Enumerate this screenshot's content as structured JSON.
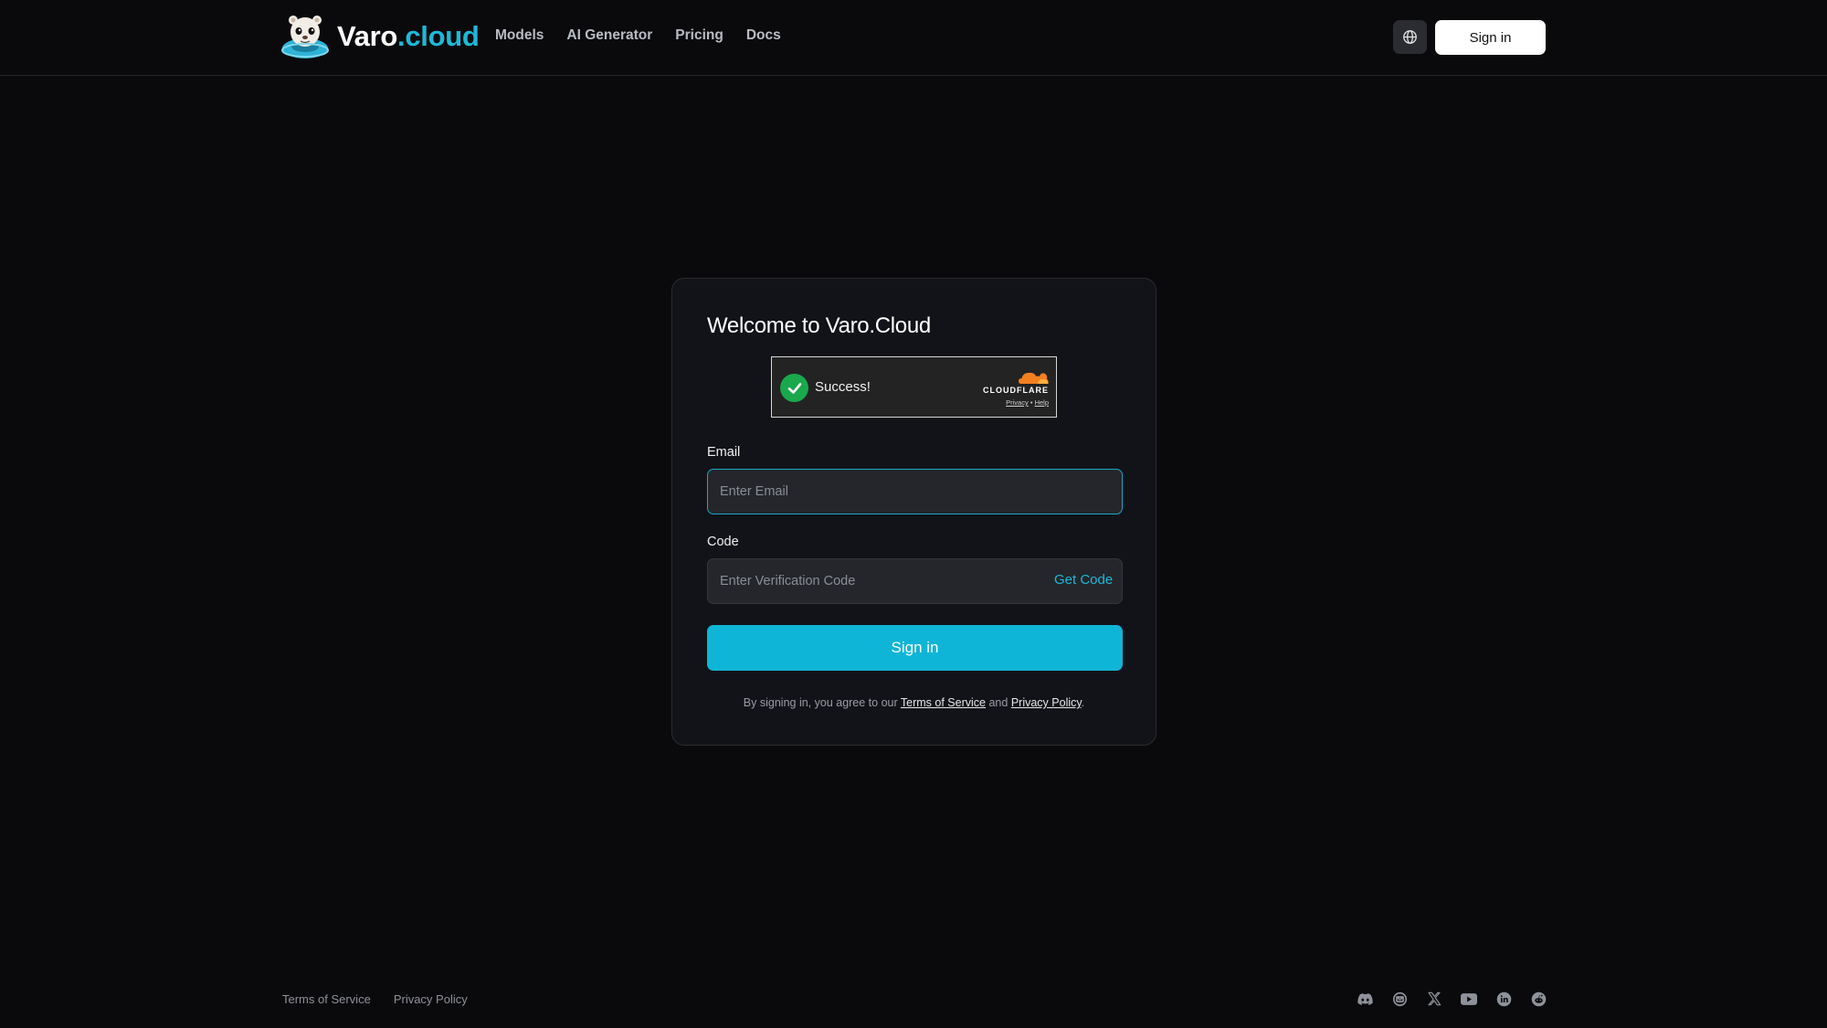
{
  "header": {
    "logo": {
      "name_main": "Varo",
      "name_accent": ".cloud"
    },
    "nav": [
      {
        "label": "Models"
      },
      {
        "label": "AI Generator"
      },
      {
        "label": "Pricing"
      },
      {
        "label": "Docs"
      }
    ],
    "language_icon": "globe-icon",
    "signin_label": "Sign in"
  },
  "card": {
    "title": "Welcome to Varo.Cloud",
    "captcha": {
      "status": "Success!",
      "brand": "CLOUDFLARE",
      "privacy_link": "Privacy",
      "separator": "•",
      "help_link": "Help"
    },
    "email": {
      "label": "Email",
      "placeholder": "Enter Email",
      "value": ""
    },
    "code": {
      "label": "Code",
      "placeholder": "Enter Verification Code",
      "value": "",
      "get_code_label": "Get Code"
    },
    "signin_label": "Sign in",
    "agreement": {
      "prefix": "By signing in, you agree to our",
      "terms": "Terms of Service",
      "and": "and",
      "privacy": "Privacy Policy",
      "suffix": "."
    }
  },
  "footer": {
    "links": [
      {
        "label": "Terms of Service"
      },
      {
        "label": "Privacy Policy"
      }
    ],
    "social_icons": [
      "discord-icon",
      "mail-icon",
      "x-icon",
      "youtube-icon",
      "linkedin-icon",
      "reddit-icon"
    ]
  },
  "colors": {
    "accent": "#1fb8d8",
    "button": "#0fb5d6",
    "background": "#0a0a0c",
    "card": "#121318",
    "success": "#1aa84d"
  }
}
